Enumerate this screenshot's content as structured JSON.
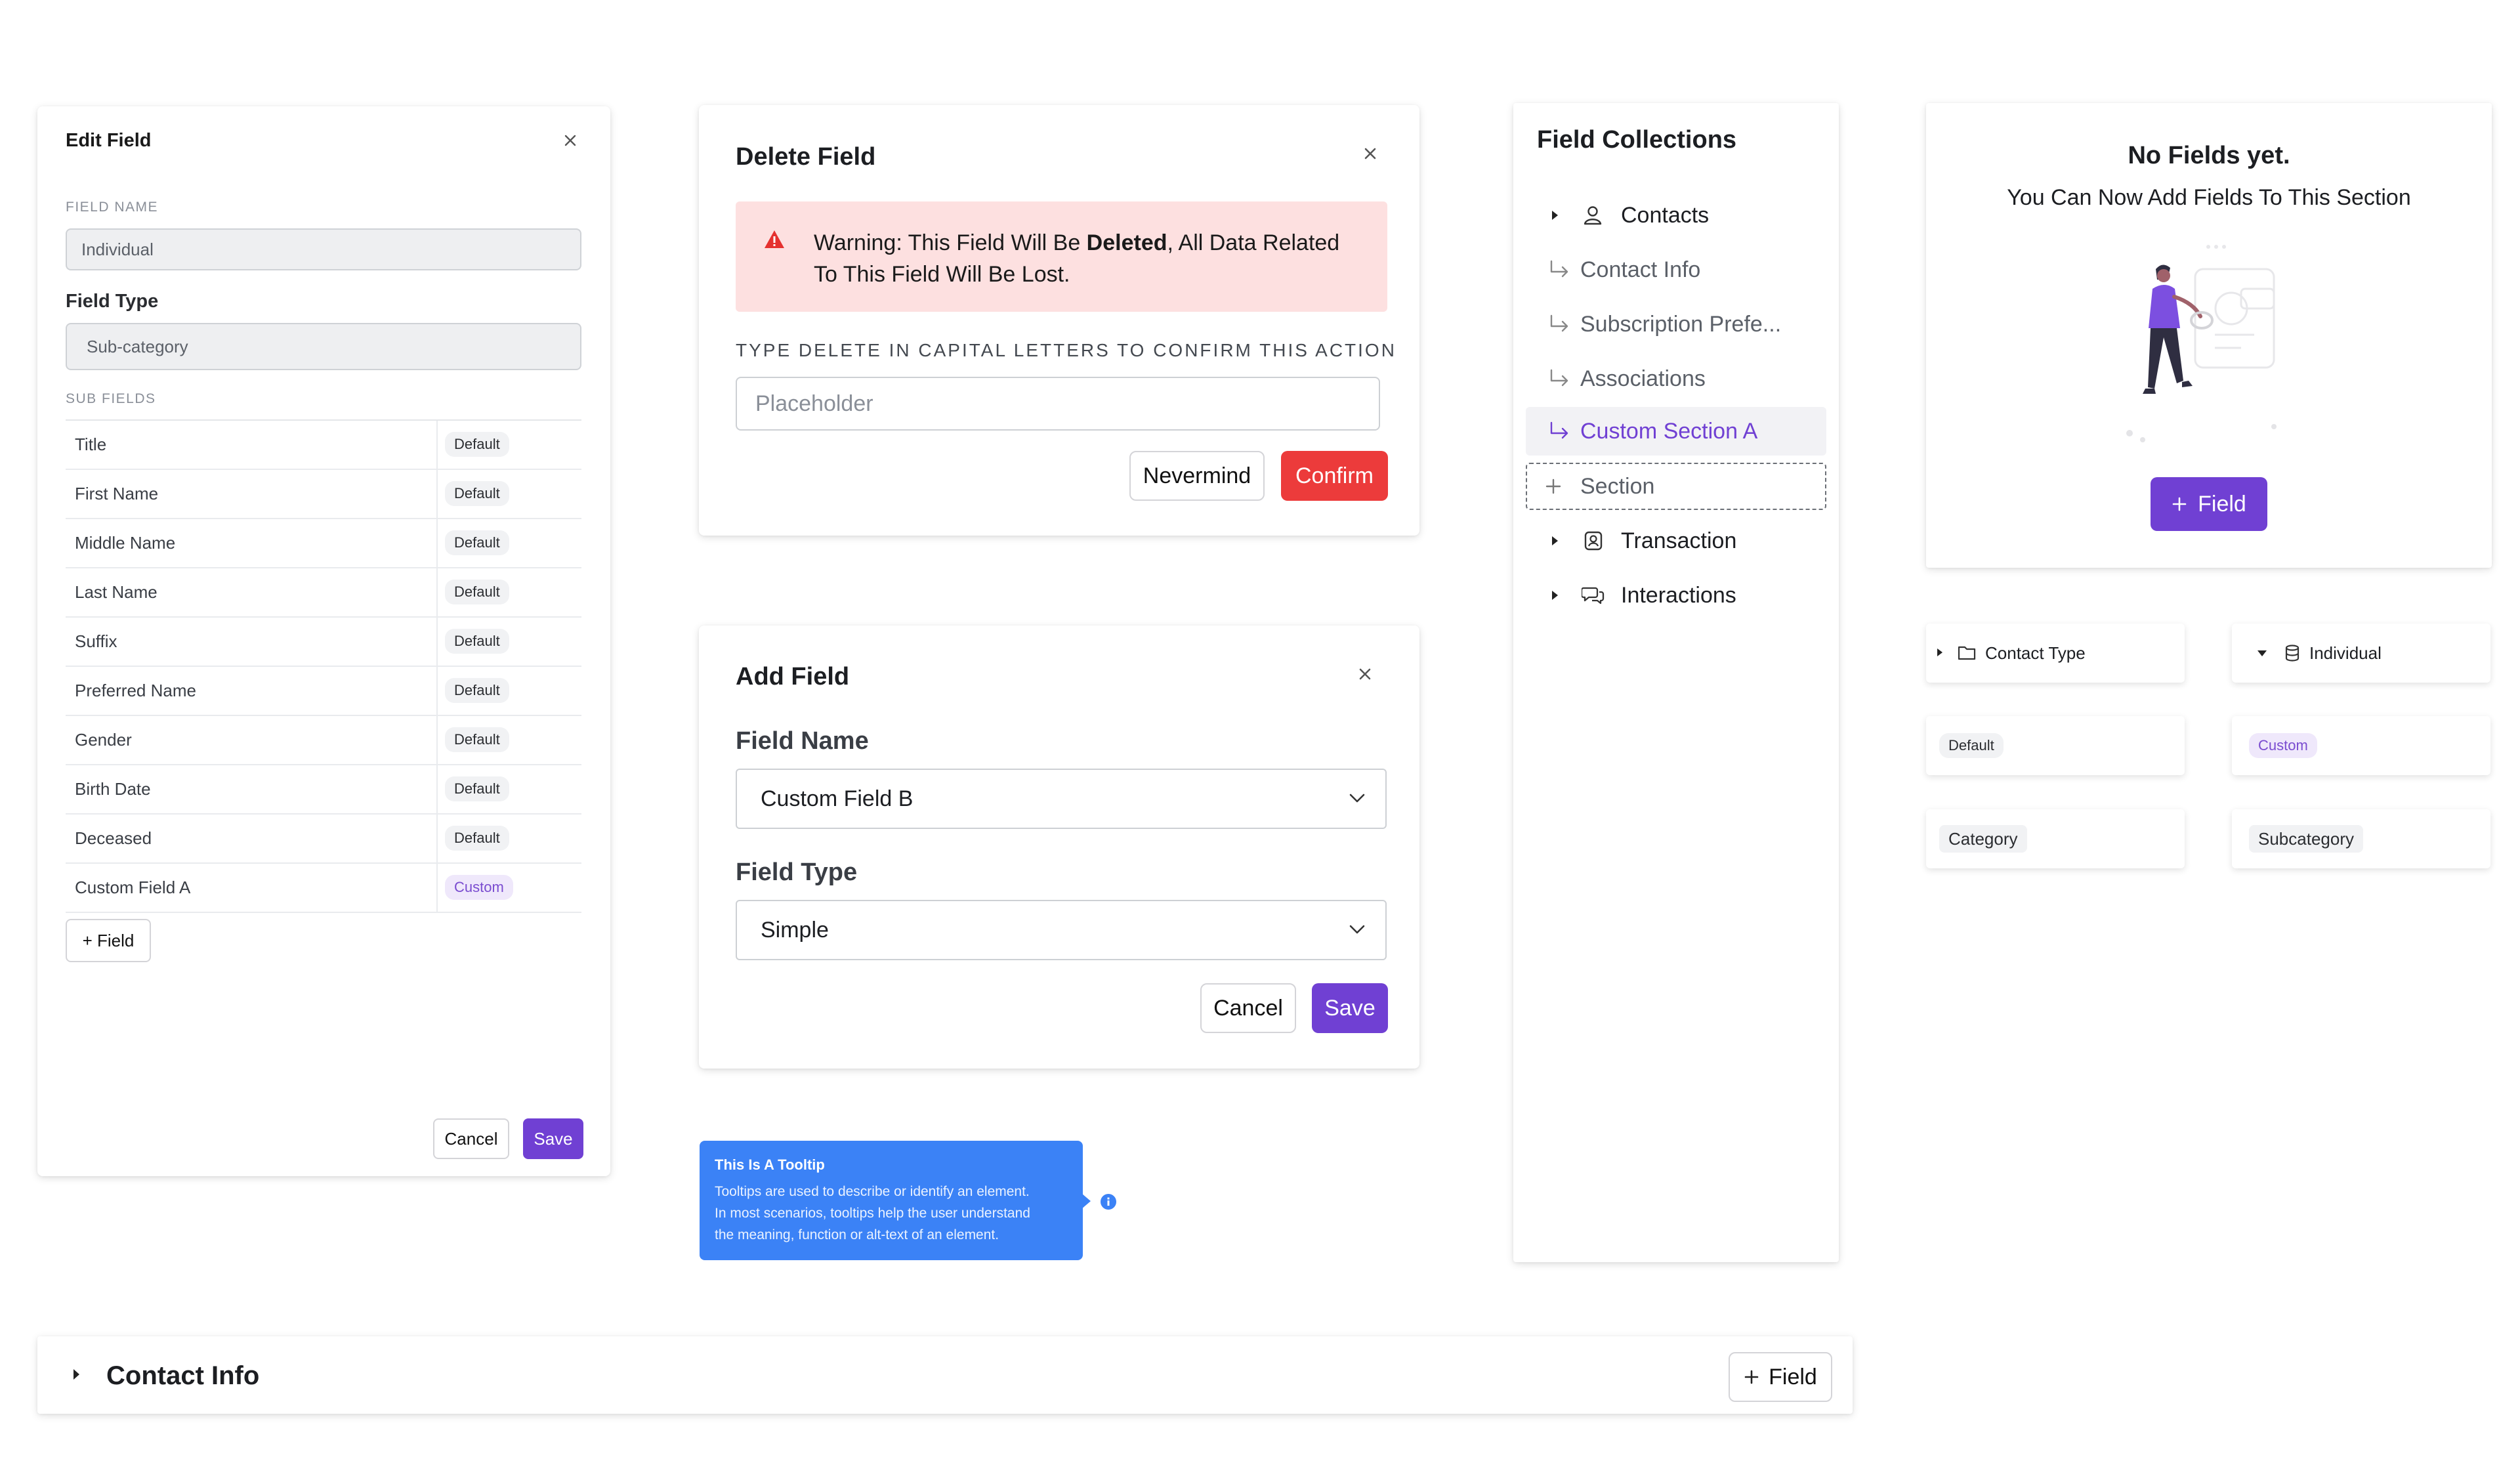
{
  "edit_field": {
    "title": "Edit Field",
    "field_name_label": "FIELD NAME",
    "field_name_value": "Individual",
    "field_type_label": "Field Type",
    "field_type_value": "Sub-category",
    "sub_fields_label": "SUB FIELDS",
    "rows": [
      {
        "name": "Title",
        "tag": "Default"
      },
      {
        "name": "First Name",
        "tag": "Default"
      },
      {
        "name": "Middle Name",
        "tag": "Default"
      },
      {
        "name": "Last Name",
        "tag": "Default"
      },
      {
        "name": "Suffix",
        "tag": "Default"
      },
      {
        "name": "Preferred Name",
        "tag": "Default"
      },
      {
        "name": "Gender",
        "tag": "Default"
      },
      {
        "name": "Birth Date",
        "tag": "Default"
      },
      {
        "name": "Deceased",
        "tag": "Default"
      },
      {
        "name": "Custom Field A",
        "tag": "Custom"
      }
    ],
    "add_field_label": "+ Field",
    "cancel_label": "Cancel",
    "save_label": "Save"
  },
  "delete_field": {
    "title": "Delete Field",
    "warning_prefix": "Warning: This Field Will Be ",
    "warning_bold": "Deleted",
    "warning_suffix": ", All Data Related",
    "warning_line2": "To This Field Will Be Lost.",
    "confirm_instruction": "TYPE DELETE IN CAPITAL LETTERS TO CONFIRM THIS ACTION",
    "input_placeholder": "Placeholder",
    "nevermind_label": "Nevermind",
    "confirm_label": "Confirm"
  },
  "add_field": {
    "title": "Add Field",
    "field_name_label": "Field Name",
    "field_name_value": "Custom Field B",
    "field_type_label": "Field Type",
    "field_type_value": "Simple",
    "cancel_label": "Cancel",
    "save_label": "Save"
  },
  "tooltip": {
    "title": "This Is A Tooltip",
    "line1": "Tooltips are used to describe or identify an element.",
    "line2": "In most scenarios, tooltips help the user understand",
    "line3": "the meaning, function or alt-text of an element."
  },
  "field_collections": {
    "title": "Field Collections",
    "items": [
      {
        "label": "Contacts",
        "kind": "group",
        "icon": "person-icon"
      },
      {
        "label": "Contact Info",
        "kind": "sub"
      },
      {
        "label": "Subscription Prefe...",
        "kind": "sub"
      },
      {
        "label": "Associations",
        "kind": "sub"
      },
      {
        "label": "Custom Section A",
        "kind": "active"
      },
      {
        "label": "Section",
        "kind": "add"
      },
      {
        "label": "Transaction",
        "kind": "group",
        "icon": "badge-person-icon"
      },
      {
        "label": "Interactions",
        "kind": "group",
        "icon": "chat-bubbles-icon"
      }
    ]
  },
  "no_fields": {
    "title": "No Fields yet.",
    "subtitle": "You Can Now Add Fields To This Section",
    "button_label": "Field"
  },
  "mini_cards": {
    "contact_type": "Contact Type",
    "individual": "Individual",
    "default": "Default",
    "custom": "Custom",
    "category": "Category",
    "subcategory": "Subcategory"
  },
  "contact_info_bar": {
    "title": "Contact Info",
    "button_label": "Field"
  },
  "colors": {
    "accent_purple": "#7040d3",
    "danger_red": "#ec3b3b",
    "warning_bg": "#fde0e0",
    "tooltip_blue": "#3b82f6"
  }
}
